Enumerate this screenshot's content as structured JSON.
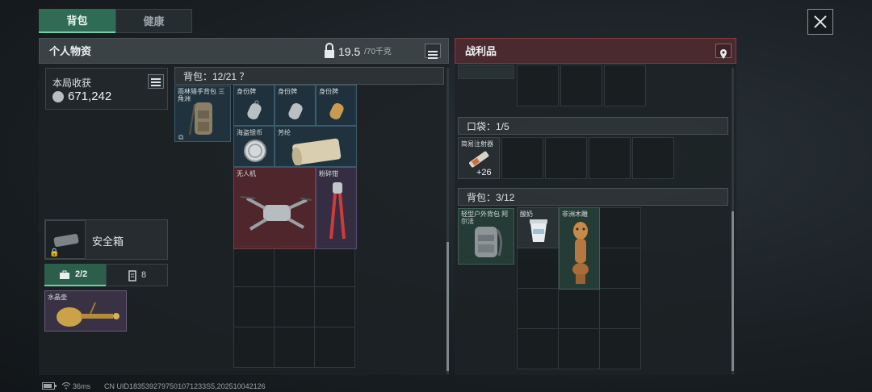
{
  "tabs": [
    {
      "label": "背包"
    },
    {
      "label": "健康"
    }
  ],
  "left_header": {
    "title": "个人物资",
    "weight_value": "19.5",
    "weight_max": "/70千克"
  },
  "round_income": {
    "label": "本局收获",
    "value": "671,242"
  },
  "backpack": {
    "label": "背包：12/21 ？"
  },
  "equipped_bag": {
    "label": "雨林猎手背包 三角洲"
  },
  "items": [
    {
      "label": "身份牌"
    },
    {
      "label": "身份牌"
    },
    {
      "label": "身份牌"
    },
    {
      "label": "海盗银币"
    },
    {
      "label": "芳纶"
    },
    {
      "label": "无人机"
    },
    {
      "label": "粉碎钳"
    }
  ],
  "safe_box": {
    "label": "安全箱"
  },
  "sub_tabs": [
    {
      "label": "2/2"
    },
    {
      "label": "8"
    }
  ],
  "safe_item": {
    "label": "水晶壶"
  },
  "right_header": {
    "title": "战利品"
  },
  "pocket": {
    "label": "口袋：1/5",
    "item_label": "简易注射器",
    "item_count": "+26"
  },
  "loot_backpack": {
    "label": "背包：3/12",
    "bag_label": "轻型户外背包 阿尔法",
    "item1_label": "酸奶",
    "item2_label": "非洲木雕"
  },
  "status_bar": {
    "ping": "36ms",
    "uid": "CN UID1835392797501071233S5,202510042126"
  },
  "colors": {
    "accent_green": "#2f6b55",
    "loot_red": "#4a2a2e",
    "drone_red": "#5c282e"
  }
}
